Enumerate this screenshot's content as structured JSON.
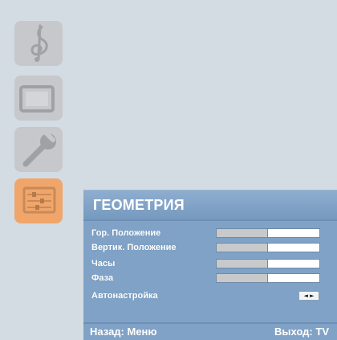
{
  "colors": {
    "background": "#d3dbe3",
    "panel": "#7fa2c6",
    "title_text": "#ffffff",
    "highlight_tile": "#f0a66a",
    "icon_tile": "#bdbfc2"
  },
  "side_menu": [
    {
      "icon": "music-note-icon",
      "selected": false
    },
    {
      "icon": "monitor-icon",
      "selected": false
    },
    {
      "icon": "wrench-icon",
      "selected": false
    },
    {
      "icon": "geometry-sliders-icon",
      "selected": true
    }
  ],
  "panel": {
    "title": "ГЕОМЕТРИЯ",
    "rows": [
      {
        "label": "Гор. Положение",
        "control": "bar",
        "value_fraction": 0.5
      },
      {
        "label": "Вертик. Положение",
        "control": "bar",
        "value_fraction": 0.5
      },
      {
        "label": "Часы",
        "control": "bar",
        "value_fraction": 0.5
      },
      {
        "label": "Фаза",
        "control": "bar",
        "value_fraction": 0.5
      },
      {
        "label": "Автонастройка",
        "control": "arrows",
        "arrows_text": "◄ ►"
      }
    ],
    "footer": {
      "back": "Назад: Меню",
      "exit": "Выход: TV"
    }
  }
}
